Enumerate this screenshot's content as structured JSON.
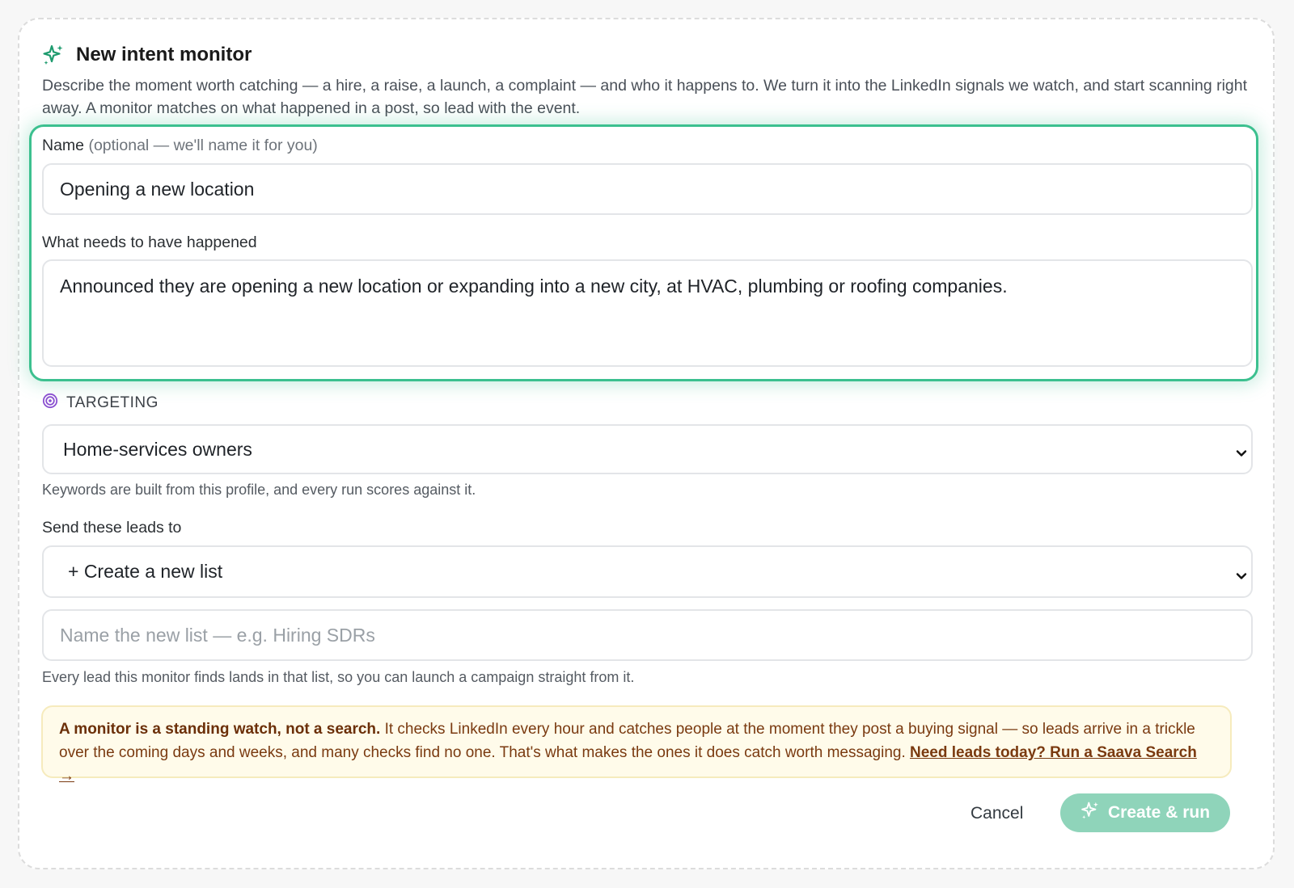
{
  "header": {
    "title": "New intent monitor",
    "description": "Describe the moment worth catching — a hire, a raise, a launch, a complaint — and who it happens to. We turn it into the LinkedIn signals we watch, and start scanning right away. A monitor matches on what happened in a post, so lead with the event."
  },
  "form": {
    "name_label": "Name",
    "name_hint": "(optional — we'll name it for you)",
    "name_value": "Opening a new location",
    "event_label": "What needs to have happened",
    "event_value": "Announced they are opening a new location or expanding into a new city, at HVAC, plumbing or roofing companies.",
    "targeting_label": "TARGETING",
    "targeting_value": "Home-services owners",
    "targeting_help": "Keywords are built from this profile, and every run scores against it.",
    "send_label": "Send these leads to",
    "send_value": "+ Create a new list",
    "new_list_placeholder": "Name the new list — e.g. Hiring SDRs",
    "send_help": "Every lead this monitor finds lands in that list, so you can launch a campaign straight from it."
  },
  "notice": {
    "bold": "A monitor is a standing watch, not a search.",
    "body": " It checks LinkedIn every hour and catches people at the moment they post a buying signal — so leads arrive in a trickle over the coming days and weeks, and many checks find no one. That's what makes the ones it does catch worth messaging. ",
    "link": "Need leads today? Run a Saava Search →"
  },
  "actions": {
    "cancel": "Cancel",
    "create": "Create & run"
  },
  "icons": {
    "header": "sparkles-icon",
    "targeting": "target-icon",
    "chevron": "chevron-down-icon",
    "create": "sparkles-icon"
  },
  "colors": {
    "accent": "#3cc08f",
    "accent_dark": "#1e9b6e",
    "button_disabled": "#8fd4ba",
    "targeting": "#8a4fd0",
    "notice_bg": "#fffbea",
    "notice_text": "#7a3a10"
  }
}
